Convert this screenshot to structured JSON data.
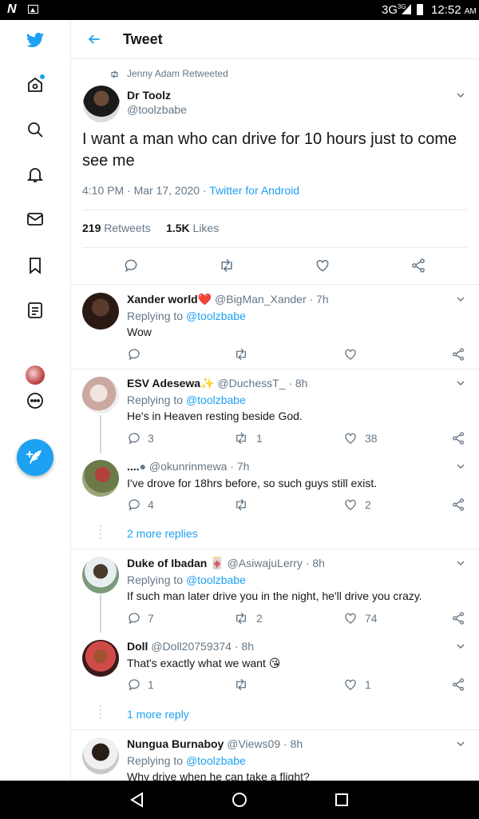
{
  "status_bar": {
    "network": "3G",
    "network_sup": "3G",
    "time": "12:52",
    "ampm": "AM"
  },
  "header": {
    "title": "Tweet"
  },
  "tweet": {
    "retweeted_by": "Jenny Adam Retweeted",
    "name": "Dr Toolz",
    "handle": "@toolzbabe",
    "text": "I want a man who can drive for 10 hours just to come see me",
    "time": "4:10 PM · Mar 17, 2020 · ",
    "source": "Twitter for Android",
    "retweets": "219",
    "retweets_label": "Retweets",
    "likes": "1.5K",
    "likes_label": "Likes"
  },
  "replies": [
    {
      "name": "Xander world",
      "emoji": "❤️",
      "handle": "@BigMan_Xander",
      "time": "· 7h",
      "replying": "Replying to ",
      "mention": "@toolzbabe",
      "text": "Wow",
      "comments": "",
      "retweets": "",
      "likes": ""
    },
    {
      "name": "ESV Adesewa",
      "emoji": "✨",
      "handle": "@DuchessT_",
      "time": "· 8h",
      "replying": "Replying to ",
      "mention": "@toolzbabe",
      "text": "He's in Heaven resting beside God.",
      "comments": "3",
      "retweets": "1",
      "likes": "38"
    },
    {
      "name": "....",
      "emoji": "●",
      "handle": "@okunrinmewa",
      "time": "· 7h",
      "text": "I've drove for 18hrs before, so such guys still exist.",
      "comments": "4",
      "retweets": "",
      "likes": "2"
    },
    {
      "name": "Duke of Ibadan",
      "emoji": "🀄",
      "handle": "@AsiwajuLerry",
      "time": "· 8h",
      "replying": "Replying to ",
      "mention": "@toolzbabe",
      "text": "If such man later drive you in the night, he'll drive you crazy.",
      "comments": "7",
      "retweets": "2",
      "likes": "74"
    },
    {
      "name": "Doll",
      "handle": "@Doll20759374",
      "time": "· 8h",
      "text": "That's exactly what we want 😘",
      "comments": "1",
      "retweets": "",
      "likes": "1"
    },
    {
      "name": "Nungua Burnaboy",
      "handle": "@Views09",
      "time": "· 8h",
      "replying": "Replying to ",
      "mention": "@toolzbabe",
      "text": "Why drive when he can take a flight?"
    }
  ],
  "more_replies_1": "2 more replies",
  "more_replies_2": "1 more reply",
  "colors": {
    "accent": "#1da1f2",
    "muted": "#657786",
    "divider": "#e6ecf0"
  }
}
